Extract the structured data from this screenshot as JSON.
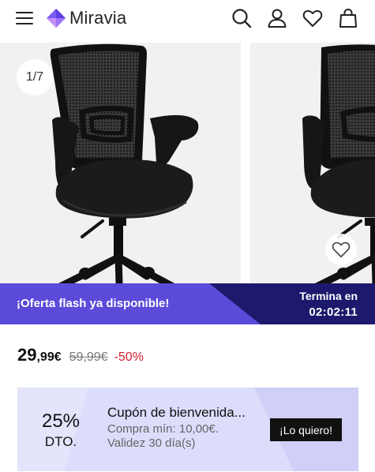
{
  "header": {
    "logo_text": "Miravia",
    "icons": [
      "menu-icon",
      "search-icon",
      "user-icon",
      "heart-icon",
      "bag-icon"
    ]
  },
  "gallery": {
    "counter": "1/7",
    "fav_icon": "heart-icon"
  },
  "flash": {
    "text": "¡Oferta flash ya disponible!",
    "ends_label": "Termina en",
    "timer": "02:02:11"
  },
  "price": {
    "current_int": "29",
    "current_dec": ",99€",
    "old": "59,99€",
    "discount": "-50%"
  },
  "coupon": {
    "percent": "25%",
    "dto": "DTO.",
    "title": "Cupón de bienvenida...",
    "min": "Compra mín: 10,00€.",
    "validity": "Validez 30 día(s)",
    "button": "¡Lo quiero!"
  },
  "colors": {
    "flash_purple": "#5b4bd9",
    "flash_dark": "#1d1a6d",
    "discount_red": "#d4202e",
    "coupon_bg": "#dcdcfb"
  }
}
